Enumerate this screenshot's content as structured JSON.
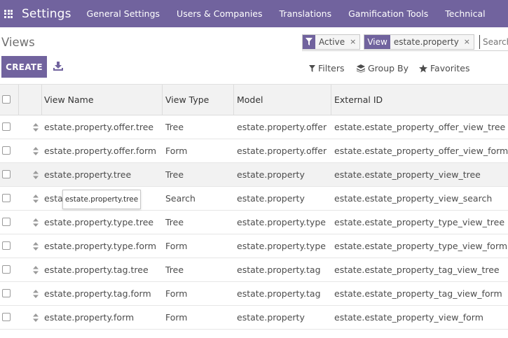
{
  "navbar": {
    "app_name": "Settings",
    "menu": [
      "General Settings",
      "Users & Companies",
      "Translations",
      "Gamification Tools",
      "Technical"
    ]
  },
  "control_panel": {
    "breadcrumb": "Views",
    "create_label": "CREATE",
    "facets": [
      {
        "icon": "filter-icon",
        "value": "Active"
      },
      {
        "label": "View",
        "value": "estate.property"
      }
    ],
    "search_placeholder": "Search...",
    "filters_label": "Filters",
    "group_by_label": "Group By",
    "favorites_label": "Favorites"
  },
  "table": {
    "columns": [
      "View Name",
      "View Type",
      "Model",
      "External ID"
    ],
    "rows": [
      {
        "name": "estate.property.offer.tree",
        "type": "Tree",
        "model": "estate.property.offer",
        "external_id": "estate.estate_property_offer_view_tree"
      },
      {
        "name": "estate.property.offer.form",
        "type": "Form",
        "model": "estate.property.offer",
        "external_id": "estate.estate_property_offer_view_form"
      },
      {
        "name": "estate.property.tree",
        "type": "Tree",
        "model": "estate.property",
        "external_id": "estate.estate_property_view_tree"
      },
      {
        "name": "estat",
        "type": "Search",
        "model": "estate.property",
        "external_id": "estate.estate_property_view_search"
      },
      {
        "name": "estate.property.type.tree",
        "type": "Tree",
        "model": "estate.property.type",
        "external_id": "estate.estate_property_type_view_tree"
      },
      {
        "name": "estate.property.type.form",
        "type": "Form",
        "model": "estate.property.type",
        "external_id": "estate.estate_property_type_view_form"
      },
      {
        "name": "estate.property.tag.tree",
        "type": "Tree",
        "model": "estate.property.tag",
        "external_id": "estate.estate_property_tag_view_tree"
      },
      {
        "name": "estate.property.tag.form",
        "type": "Form",
        "model": "estate.property.tag",
        "external_id": "estate.estate_property_tag_view_form"
      },
      {
        "name": "estate.property.form",
        "type": "Form",
        "model": "estate.property",
        "external_id": "estate.estate_property_view_form"
      }
    ]
  },
  "tooltip": {
    "text": "estate.property.tree"
  },
  "colors": {
    "brand": "#71639e",
    "header_bg": "#f2f2f2"
  }
}
